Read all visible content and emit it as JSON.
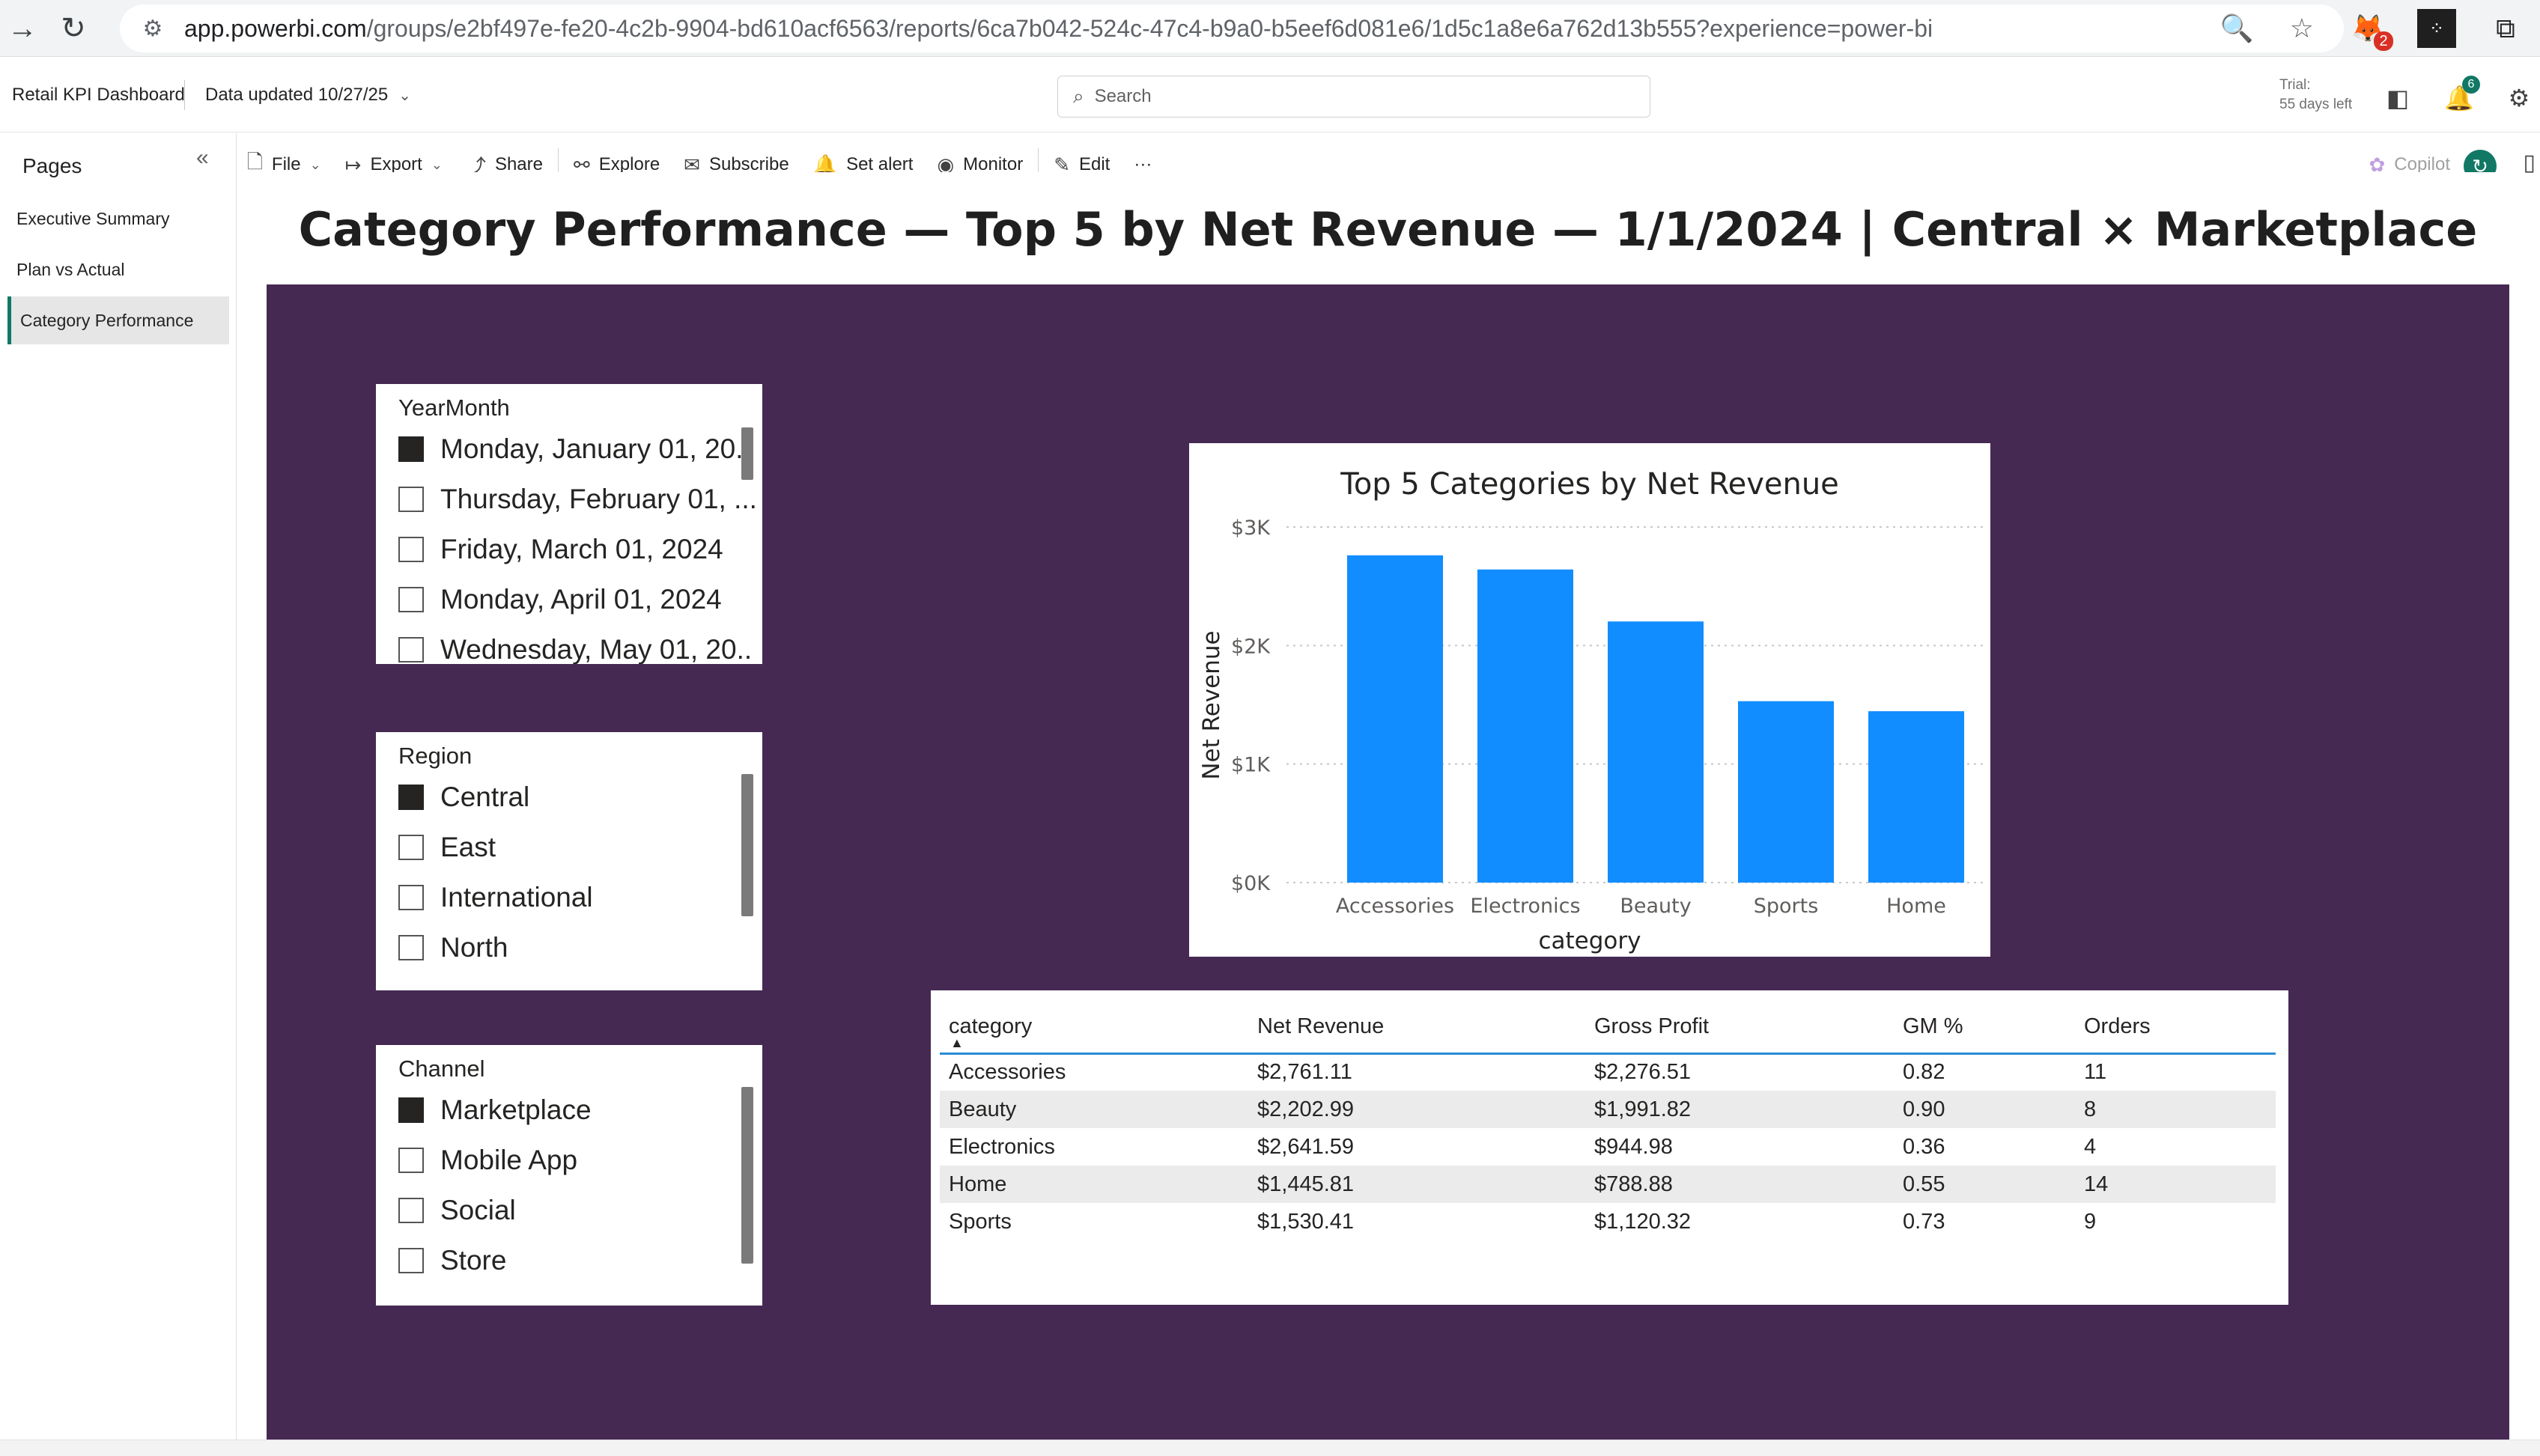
{
  "browser": {
    "url_host": "app.powerbi.com",
    "url_path": "/groups/e2bf497e-fe20-4c2b-9904-bd610acf6563/reports/6ca7b042-524c-47c4-b9a0-b5eef6d081e6/1d5c1a8e6a762d13b555?experience=power-bi",
    "ext_badge": "2"
  },
  "header": {
    "app_title": "Retail KPI Dashboard",
    "data_updated": "Data updated 10/27/25",
    "search_placeholder": "Search",
    "trial_line1": "Trial:",
    "trial_line2": "55 days left",
    "notification_count": "6"
  },
  "toolbar": {
    "file": "File",
    "export": "Export",
    "share": "Share",
    "explore": "Explore",
    "subscribe": "Subscribe",
    "set_alert": "Set alert",
    "monitor": "Monitor",
    "edit": "Edit",
    "more": "···",
    "copilot": "Copilot"
  },
  "pages": {
    "title": "Pages",
    "items": [
      {
        "label": "Executive Summary"
      },
      {
        "label": "Plan vs Actual"
      },
      {
        "label": "Category Performance"
      }
    ]
  },
  "report": {
    "title": "Category Performance — Top 5 by Net Revenue — 1/1/2024 | Central × Marketplace"
  },
  "slicers": {
    "yearmonth": {
      "title": "YearMonth",
      "items": [
        {
          "label": "Monday, January 01, 20..",
          "checked": true
        },
        {
          "label": "Thursday, February 01, ...",
          "checked": false
        },
        {
          "label": "Friday, March 01, 2024",
          "checked": false
        },
        {
          "label": "Monday, April 01, 2024",
          "checked": false
        },
        {
          "label": "Wednesday, May 01, 20..",
          "checked": false
        }
      ]
    },
    "region": {
      "title": "Region",
      "items": [
        {
          "label": "Central",
          "checked": true
        },
        {
          "label": "East",
          "checked": false
        },
        {
          "label": "International",
          "checked": false
        },
        {
          "label": "North",
          "checked": false
        }
      ]
    },
    "channel": {
      "title": "Channel",
      "items": [
        {
          "label": "Marketplace",
          "checked": true
        },
        {
          "label": "Mobile App",
          "checked": false
        },
        {
          "label": "Social",
          "checked": false
        },
        {
          "label": "Store",
          "checked": false
        }
      ]
    }
  },
  "chart_data": {
    "type": "bar",
    "title": "Top 5 Categories by Net Revenue",
    "xlabel": "category",
    "ylabel": "Net Revenue",
    "categories": [
      "Accessories",
      "Electronics",
      "Beauty",
      "Sports",
      "Home"
    ],
    "values": [
      2761.11,
      2641.59,
      2202.99,
      1530.41,
      1445.81
    ],
    "ylim": [
      0,
      3000
    ],
    "yticks": [
      "$0K",
      "$1K",
      "$2K",
      "$3K"
    ],
    "color": "#118DFF",
    "grid": true
  },
  "table": {
    "columns": [
      "category",
      "Net Revenue",
      "Gross Profit",
      "GM %",
      "Orders"
    ],
    "rows": [
      [
        "Accessories",
        "$2,761.11",
        "$2,276.51",
        "0.82",
        "11"
      ],
      [
        "Beauty",
        "$2,202.99",
        "$1,991.82",
        "0.90",
        "8"
      ],
      [
        "Electronics",
        "$2,641.59",
        "$944.98",
        "0.36",
        "4"
      ],
      [
        "Home",
        "$1,445.81",
        "$788.88",
        "0.55",
        "14"
      ],
      [
        "Sports",
        "$1,530.41",
        "$1,120.32",
        "0.73",
        "9"
      ]
    ]
  }
}
